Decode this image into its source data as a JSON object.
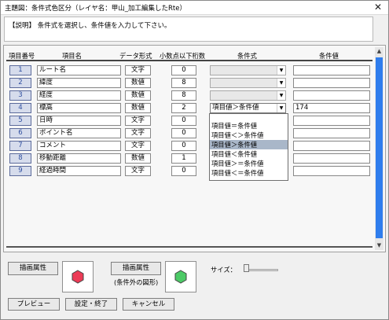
{
  "window": {
    "title": "主題図：条件式色区分（レイヤ名：甲山_加工編集したRte）",
    "close_glyph": "✕"
  },
  "description": "【説明】 条件式を選択し、条件値を入力して下さい。",
  "columns": [
    "項目番号",
    "項目名",
    "データ形式",
    "小数点以下桁数",
    "条件式",
    "条件値"
  ],
  "rows": [
    {
      "num": "1",
      "name": "ルート名",
      "dtype": "文字",
      "decimals": "0",
      "condition": "",
      "value": ""
    },
    {
      "num": "2",
      "name": "緯度",
      "dtype": "数値",
      "decimals": "8",
      "condition": "",
      "value": ""
    },
    {
      "num": "3",
      "name": "経度",
      "dtype": "数値",
      "decimals": "8",
      "condition": "",
      "value": ""
    },
    {
      "num": "4",
      "name": "標高",
      "dtype": "数値",
      "decimals": "2",
      "condition": "項目値＞条件値",
      "value": "174"
    },
    {
      "num": "5",
      "name": "日時",
      "dtype": "文字",
      "decimals": "0",
      "condition": "",
      "value": ""
    },
    {
      "num": "6",
      "name": "ポイント名",
      "dtype": "文字",
      "decimals": "0",
      "condition": "",
      "value": ""
    },
    {
      "num": "7",
      "name": "コメント",
      "dtype": "文字",
      "decimals": "0",
      "condition": "",
      "value": ""
    },
    {
      "num": "8",
      "name": "移動距離",
      "dtype": "数値",
      "decimals": "1",
      "condition": "",
      "value": ""
    },
    {
      "num": "9",
      "name": "経過時間",
      "dtype": "文字",
      "decimals": "0",
      "condition": "",
      "value": ""
    }
  ],
  "dropdown": {
    "options": [
      "項目値＝条件値",
      "項目値＜＞条件値",
      "項目値＞条件値",
      "項目値＜条件値",
      "項目値＞＝条件値",
      "項目値＜＝条件値"
    ],
    "selected_index": 2
  },
  "bottom": {
    "draw_attr_label": "描画属性",
    "draw_attr_else_label": "描画属性",
    "else_note": "(条件外の図形)",
    "size_label": "サイズ：",
    "size_level": 0.0,
    "preview_label": "プレビュー",
    "ok_label": "設定・終了",
    "cancel_label": "キャンセル",
    "symbol_color": "#ec3b56",
    "else_symbol_color": "#4cca66"
  },
  "colors": {
    "scroll_thumb": "#2f7ded",
    "selected_option": "#a9b7c9"
  }
}
